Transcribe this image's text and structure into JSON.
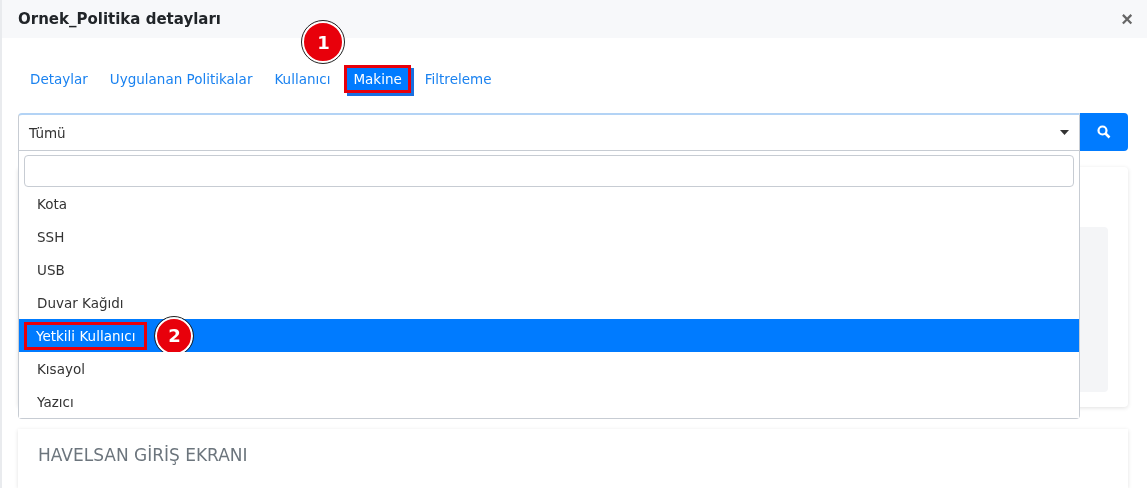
{
  "dialog": {
    "title": "Ornek_Politika detayları",
    "close": "×"
  },
  "tabs": [
    {
      "label": "Detaylar",
      "selected": false
    },
    {
      "label": "Uygulanan Politikalar",
      "selected": false
    },
    {
      "label": "Kullanıcı",
      "selected": false
    },
    {
      "label": "Makine",
      "selected": true,
      "callout": "1"
    },
    {
      "label": "Filtreleme",
      "selected": false
    }
  ],
  "select": {
    "value": "Tümü",
    "expanded": true
  },
  "dropdown": {
    "options": [
      {
        "label": "Kota",
        "selected": false
      },
      {
        "label": "SSH",
        "selected": false
      },
      {
        "label": "USB",
        "selected": false
      },
      {
        "label": "Duvar Kağıdı",
        "selected": false
      },
      {
        "label": "Yetkili Kullanıcı",
        "selected": true,
        "callout": "2"
      },
      {
        "label": "Kısayol",
        "selected": false
      },
      {
        "label": "Yazıcı",
        "selected": false
      }
    ]
  },
  "section": {
    "title": "HAVELSAN GİRİŞ EKRANI"
  }
}
